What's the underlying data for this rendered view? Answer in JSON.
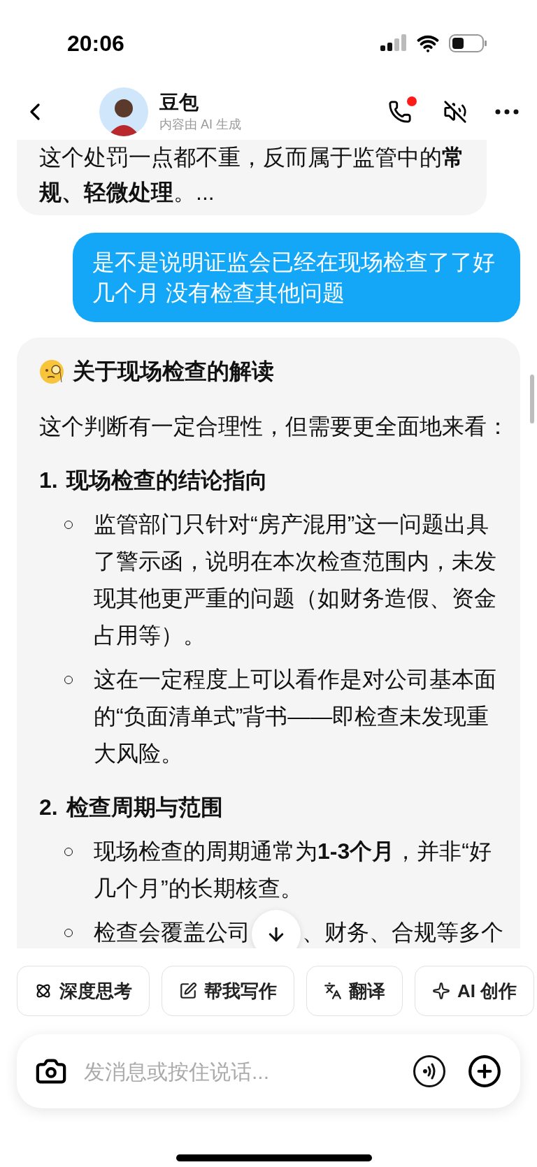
{
  "status_bar": {
    "time": "20:06"
  },
  "header": {
    "name": "豆包",
    "subtitle": "内容由 AI 生成",
    "call_notification": true
  },
  "messages": [
    {
      "kind": "assistant_text",
      "text": "这个处罚一点都不重，反而属于监管中的**常规、轻微处理**。..."
    },
    {
      "kind": "user_text",
      "text": "是不是说明证监会已经在现场检查了了好几个月 没有检查其他问题"
    },
    {
      "kind": "outline",
      "title": "关于现场检查的解读",
      "intro": "这个判断有一定合理性，但需要更全面地来看：",
      "sections": [
        {
          "number": "1.",
          "heading": "现场检查的结论指向",
          "bullets": [
            "监管部门只针对“房产混用”这一问题出具了警示函，说明在本次检查范围内，未发现其他更严重的问题（如财务造假、资金占用等）。",
            "这在一定程度上可以看作是对公司基本面的“负面清单式”背书——即检查未发现重大风险。"
          ]
        },
        {
          "number": "2.",
          "heading": "检查周期与范围",
          "bullets": [
            "现场检查的周期通常为**1-3个月**，并非“好几个月”的长期核查。",
            [
              "检查会覆盖公司",
              "、财务、合规等多个"
            ]
          ]
        }
      ]
    }
  ],
  "suggestions": [
    {
      "kind": "atom",
      "label": "深度思考"
    },
    {
      "kind": "write",
      "label": "帮我写作"
    },
    {
      "kind": "translate",
      "label": "翻译"
    },
    {
      "kind": "sparkle",
      "label": "AI 创作"
    }
  ],
  "composer": {
    "placeholder": "发消息或按住说话..."
  }
}
